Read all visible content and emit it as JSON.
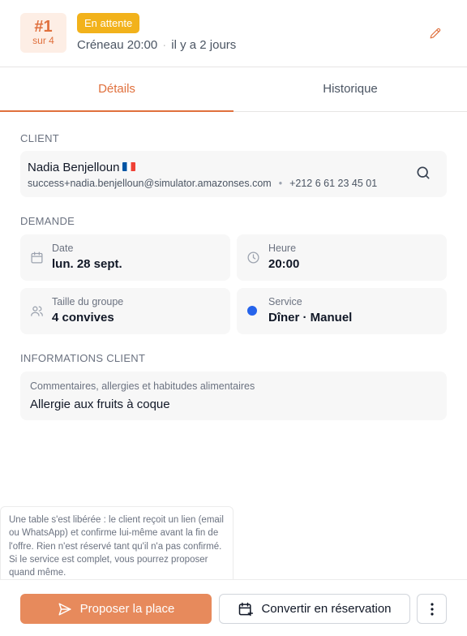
{
  "header": {
    "rank": "#1",
    "rank_of": "sur 4",
    "status": "En attente",
    "slot": "Créneau 20:00",
    "ago": "il y a 2 jours",
    "accent_color": "#e0703d",
    "status_color": "#f2b21b"
  },
  "tabs": [
    {
      "label": "Détails",
      "active": true
    },
    {
      "label": "Historique",
      "active": false
    }
  ],
  "client": {
    "section_label": "CLIENT",
    "name": "Nadia Benjelloun",
    "flag": "france-flag",
    "email": "success+nadia.benjelloun@simulator.amazonses.com",
    "phone": "+212 6 61 23 45 01"
  },
  "request": {
    "section_label": "DEMANDE",
    "date": {
      "label": "Date",
      "value": "lun. 28 sept.",
      "icon": "calendar-icon"
    },
    "time": {
      "label": "Heure",
      "value": "20:00",
      "icon": "clock-icon"
    },
    "group": {
      "label": "Taille du groupe",
      "value": "4 convives",
      "icon": "users-icon"
    },
    "service": {
      "label": "Service",
      "value": "Dîner · Manuel",
      "color": "#2563eb"
    }
  },
  "client_info": {
    "section_label": "INFORMATIONS CLIENT",
    "label": "Commentaires, allergies et habitudes alimentaires",
    "value": "Allergie aux fruits à coque"
  },
  "tooltip": {
    "text": "Une table s'est libérée : le client reçoit un lien (email ou WhatsApp) et confirme lui-même avant la fin de l'offre. Rien n'est réservé tant qu'il n'a pas confirmé. Si le service est complet, vous pourrez proposer quand même."
  },
  "footer": {
    "propose_label": "Proposer la place",
    "convert_label": "Convertir en réservation"
  }
}
